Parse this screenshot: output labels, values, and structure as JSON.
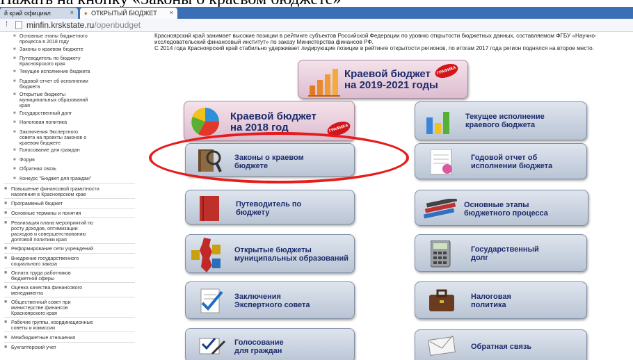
{
  "slide_caption": "Нажать на кнопку «Законы о краевом бюджете»",
  "browser": {
    "tabs": [
      {
        "label": "й край официал",
        "active": false
      },
      {
        "label": "ОТКРЫТЫЙ БЮДЖЕТ",
        "active": true
      }
    ],
    "tab_close": "×",
    "address": {
      "domain": "minfin.krskstate.ru",
      "path": "/openbudget"
    }
  },
  "sidebar": {
    "sub_items": [
      "Основные этапы бюджетного\nпроцесса в 2018 году",
      "Законы о краевом бюджете",
      "Путеводитель по бюджету\nКрасноярского края",
      "Текущее исполнение бюджета",
      "Годовой отчет об исполнении\nбюджета",
      "Открытые бюджеты\nмуниципальных образований\nкрая",
      "Государственный долг",
      "Налоговая политика",
      "Заключения Экспертного\nсовета на проекты законов о\nкраевом бюджете",
      "Голосование для граждан",
      "Форум",
      "Обратная связь",
      "Конкурс \"Бюджет для граждан\""
    ],
    "top_items": [
      "Повышение финансовой грамотности\nнаселения в Красноярском крае",
      "Программный бюджет",
      "Основные термины и понятия",
      "Реализация плана мероприятий по\nросту доходов, оптимизации\nрасходов и совершенствованию\nдолговой политики края",
      "Реформирование сети учреждений",
      "Внедрение государственного\nсоциального заказа",
      "Оплата труда работников\nбюджетной сферы",
      "Оценка качества финансового\nменеджмента",
      "Общественный совет при\nминистерстве финансов\nКрасноярского края",
      "Рабочие группы, координационные\nсоветы и комиссии",
      "Межбюджетные отношения",
      "Бухгалтерский учет"
    ]
  },
  "intro_text": "Красноярский край занимает высокие позиции в рейтинге субъектов Российской Федерации по уровню открытости бюджетных данных, составляемом ФГБУ «Научно-исследовательский финансовый институт» по заказу Министерства финансов РФ.\nС 2014 года Красноярский край стабильно удерживает лидирующие позиции в рейтинге открытости регионов, по итогам 2017 года регион поднялся на второе место.",
  "buttons": {
    "budget_2019_2021": "Краевой бюджет\nна 2019-2021 годы",
    "budget_2018": "Краевой бюджет\nна 2018 год",
    "current_execution": "Текущее исполнение\nкраевого бюджета",
    "laws": "Законы о краевом\nбюджете",
    "annual_report": "Годовой отчет об\nисполнении бюджета",
    "guide": "Путеводитель по\nбюджету",
    "stages": "Основные этапы\nбюджетного процесса",
    "open_budgets": "Открытые бюджеты\nмуниципальных образований",
    "state_debt": "Государственный\nдолг",
    "expert_conclusions": "Заключения\nЭкспертного совета",
    "tax_policy": "Налоговая\nполитика",
    "voting": "Голосование\nдля граждан",
    "feedback": "Обратная связь"
  },
  "grafika_label": "ГРАФИКА",
  "colors": {
    "highlight": "#e61c1c",
    "button_text": "#1c2c6c",
    "tabbar": "#3a6fb5"
  }
}
